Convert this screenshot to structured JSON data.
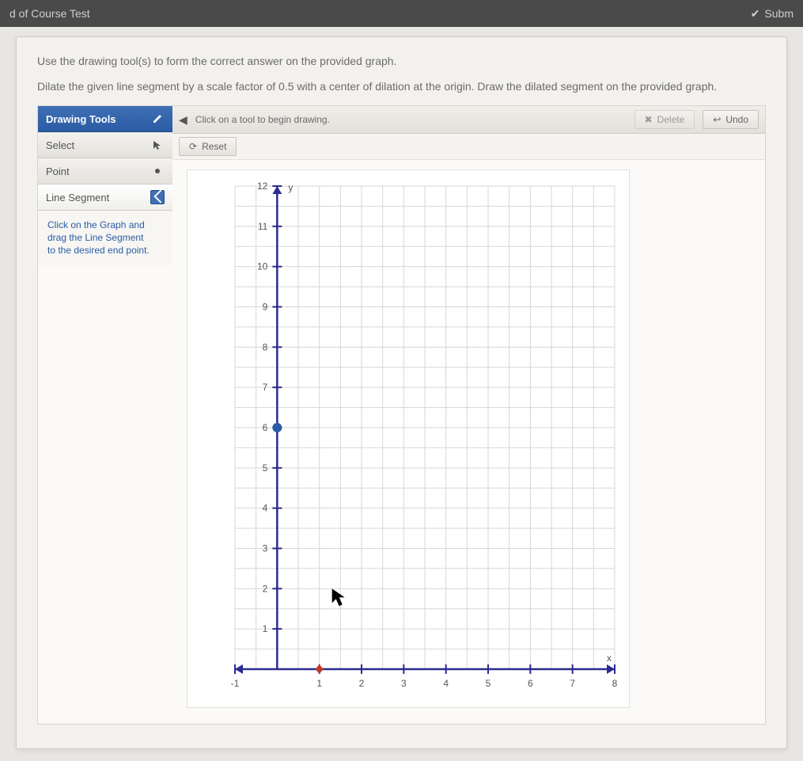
{
  "topbar": {
    "title": "d of Course Test",
    "submit": "Subm"
  },
  "instructions": {
    "line1": "Use the drawing tool(s) to form the correct answer on the provided graph.",
    "line2": "Dilate the given line segment by a scale factor of 0.5 with a center of dilation at the origin. Draw the dilated segment on the provided graph."
  },
  "tools": {
    "header": "Drawing Tools",
    "select": "Select",
    "point": "Point",
    "line_segment": "Line Segment",
    "hint_l1": "Click on the Graph and",
    "hint_l2": "drag the Line Segment",
    "hint_l3": "to the desired end point."
  },
  "hintbar": {
    "text": "Click on a tool to begin drawing."
  },
  "buttons": {
    "delete": "Delete",
    "undo": "Undo",
    "reset": "Reset"
  },
  "chart_data": {
    "type": "scatter",
    "title": "",
    "xlabel": "x",
    "ylabel": "y",
    "xlim": [
      -1,
      8
    ],
    "ylim": [
      0,
      12
    ],
    "xticks": [
      -1,
      1,
      2,
      3,
      4,
      5,
      6,
      7,
      8
    ],
    "yticks": [
      1,
      2,
      3,
      4,
      5,
      6,
      7,
      8,
      9,
      10,
      11,
      12
    ],
    "series": [
      {
        "name": "given-segment-endpoint-A",
        "values": [
          [
            0,
            6
          ]
        ]
      },
      {
        "name": "marker",
        "values": [
          [
            1,
            0
          ]
        ]
      }
    ]
  }
}
